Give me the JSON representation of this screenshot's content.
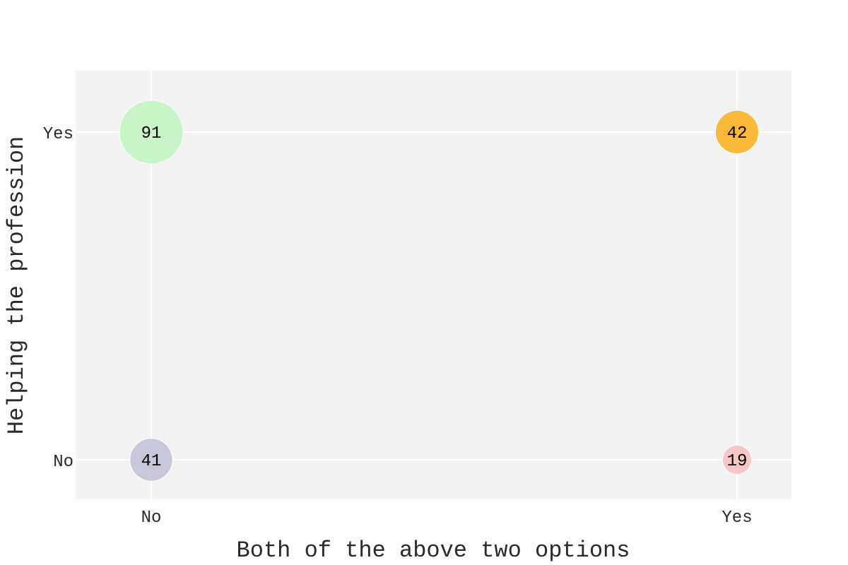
{
  "chart_data": {
    "type": "scatter",
    "title": "",
    "xlabel": "Both of the above two options",
    "ylabel": "Helping the profession",
    "x_categories": [
      "No",
      "Yes"
    ],
    "y_categories": [
      "No",
      "Yes"
    ],
    "grid": true,
    "background_color": "#f3f3f3",
    "points": [
      {
        "x": "No",
        "y": "Yes",
        "value": 91,
        "color": "#c8f5c8"
      },
      {
        "x": "Yes",
        "y": "Yes",
        "value": 42,
        "color": "#fbb93a"
      },
      {
        "x": "No",
        "y": "No",
        "value": 41,
        "color": "#c8c8da"
      },
      {
        "x": "Yes",
        "y": "No",
        "value": 19,
        "color": "#f7c6c6"
      }
    ]
  }
}
